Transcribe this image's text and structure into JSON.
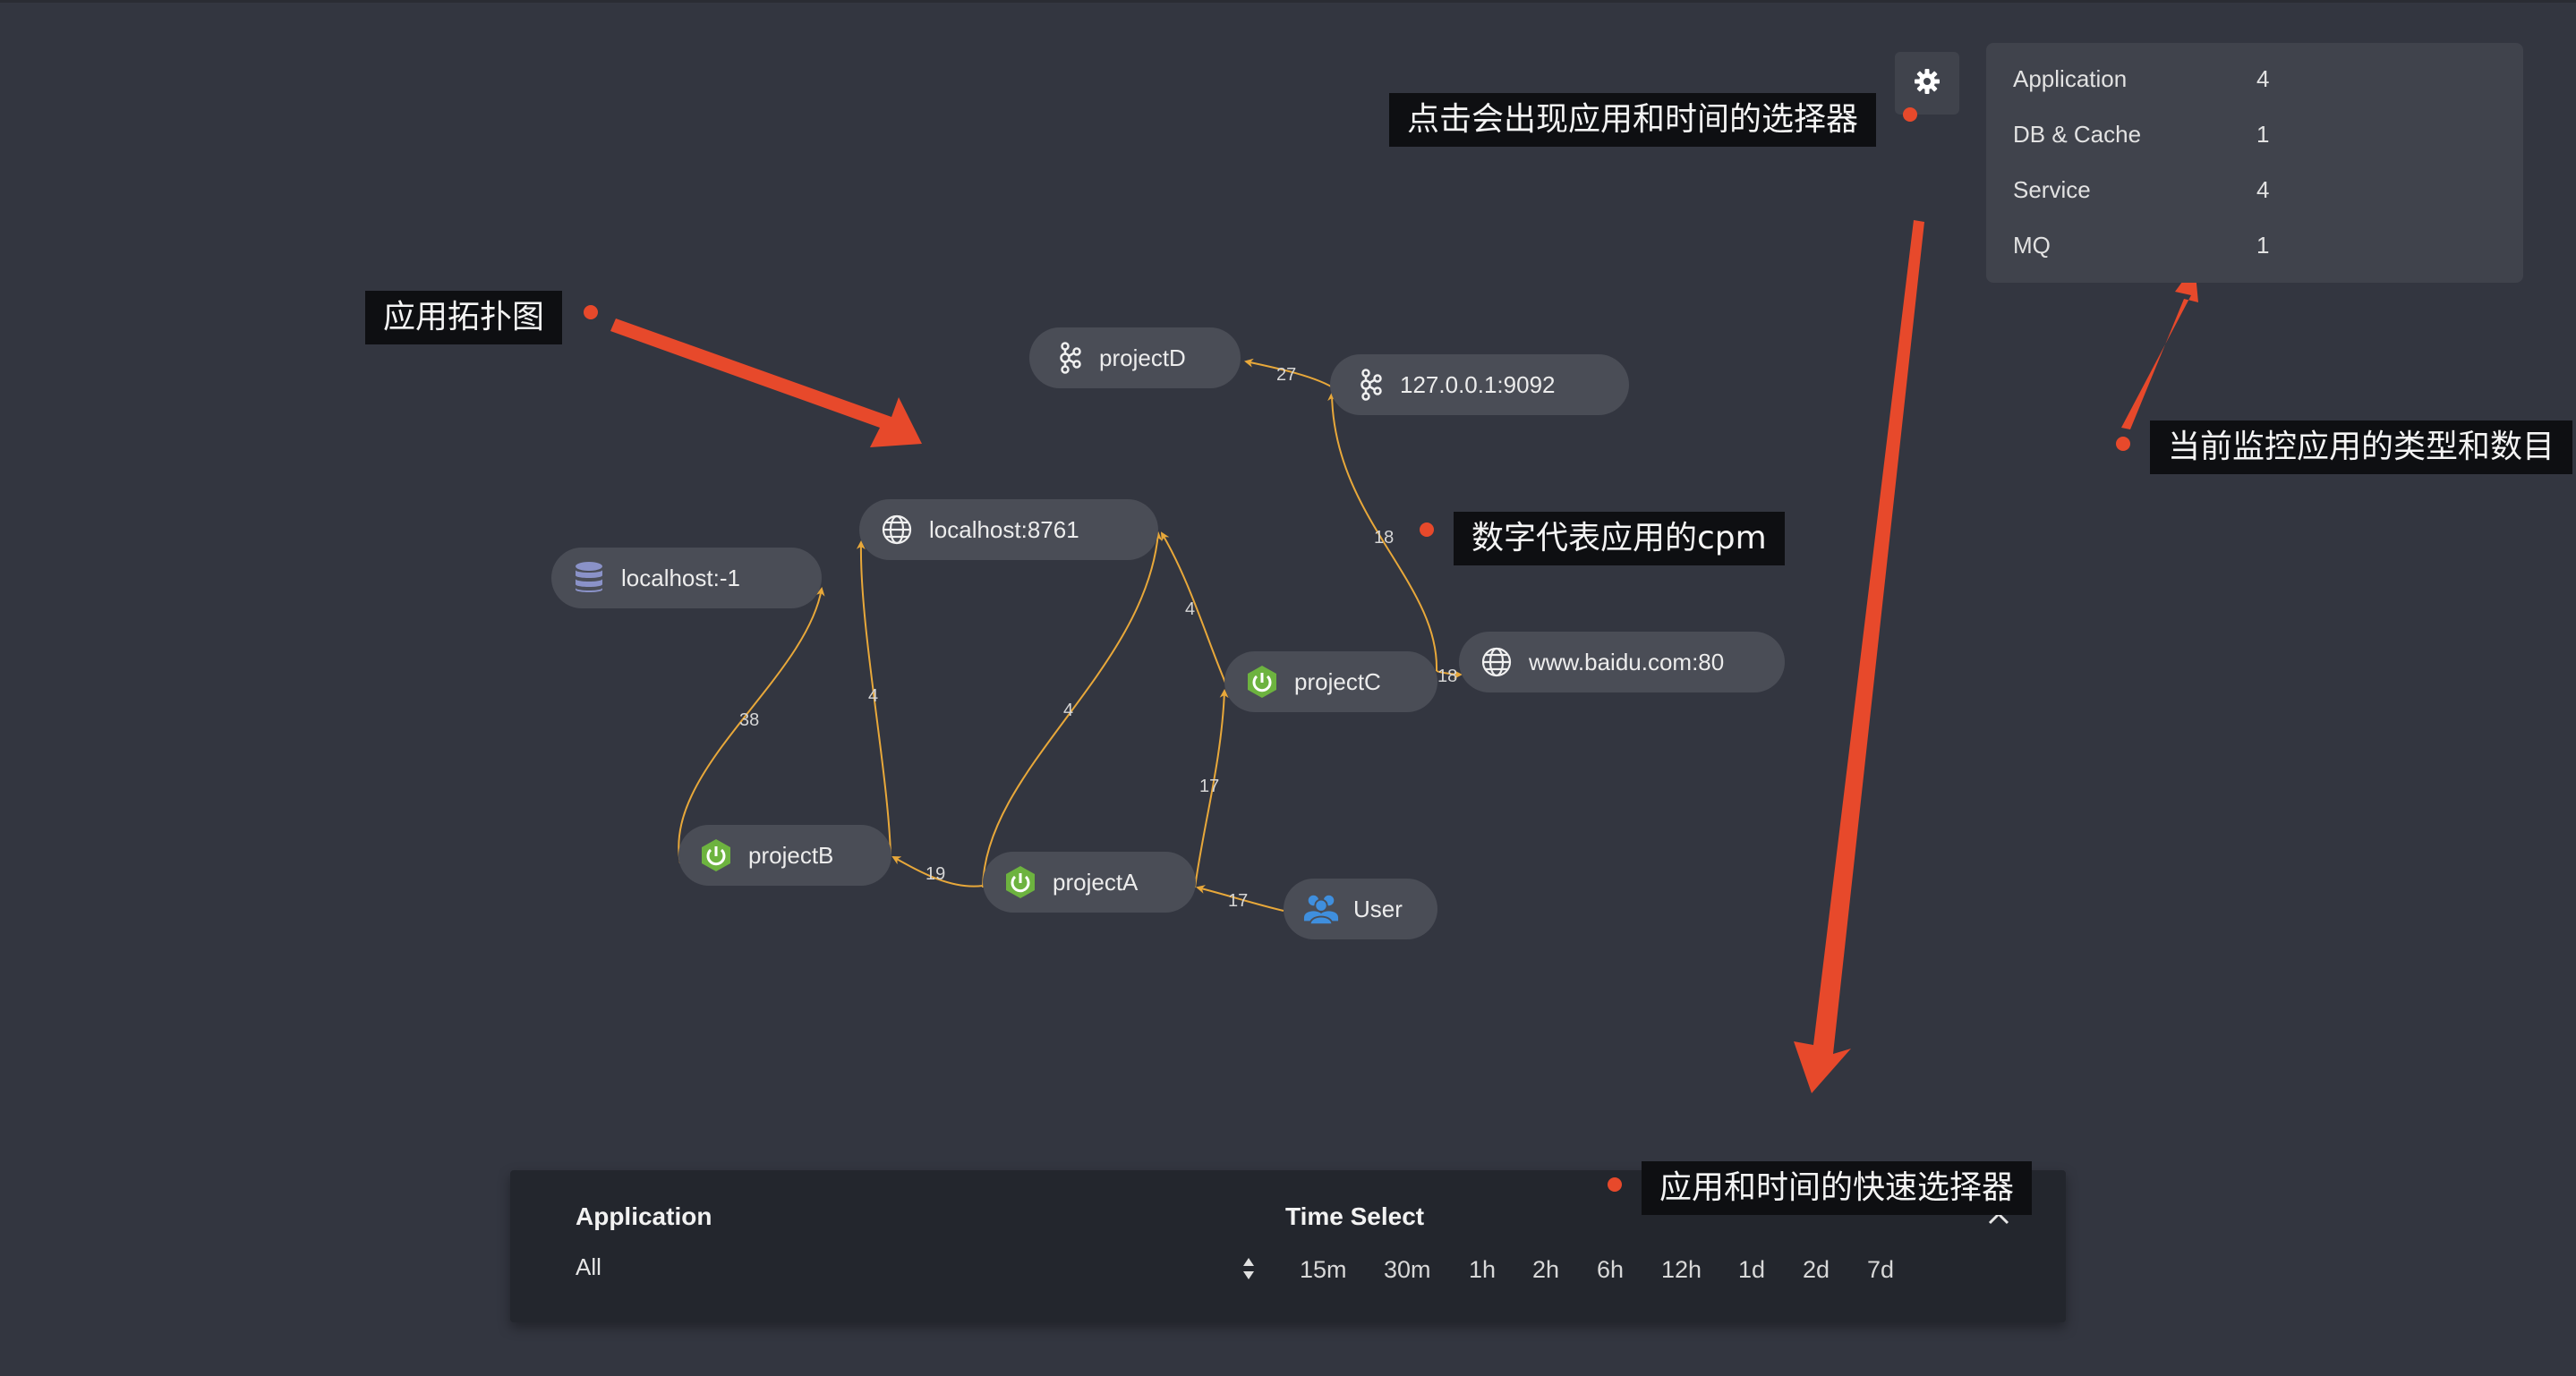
{
  "stats": {
    "rows": [
      {
        "label": "Application",
        "value": "4"
      },
      {
        "label": "DB & Cache",
        "value": "1"
      },
      {
        "label": "Service",
        "value": "4"
      },
      {
        "label": "MQ",
        "value": "1"
      }
    ]
  },
  "nodes": {
    "projectD": {
      "label": "projectD",
      "icon": "kafka-icon"
    },
    "kafka": {
      "label": "127.0.0.1:9092",
      "icon": "kafka-icon"
    },
    "localhost8761": {
      "label": "localhost:8761",
      "icon": "globe-icon"
    },
    "localhost1": {
      "label": "localhost:-1",
      "icon": "database-icon"
    },
    "projectC": {
      "label": "projectC",
      "icon": "spring-icon"
    },
    "baidu": {
      "label": "www.baidu.com:80",
      "icon": "globe-icon"
    },
    "projectB": {
      "label": "projectB",
      "icon": "spring-icon"
    },
    "projectA": {
      "label": "projectA",
      "icon": "spring-icon"
    },
    "user": {
      "label": "User",
      "icon": "users-icon"
    }
  },
  "edges": {
    "kafka_projectD": "27",
    "projectC_kafka": "18",
    "projectC_baidu": "18",
    "projectC_8761": "4",
    "projectA_8761": "4",
    "projectB_localhost1": "38",
    "projectB_8761": "4",
    "projectA_projectC": "17",
    "projectA_projectB": "19",
    "user_projectA": "17"
  },
  "callouts": {
    "settings": "点击会出现应用和时间的选择器",
    "topology": "应用拓扑图",
    "cpm": "数字代表应用的cpm",
    "stats": "当前监控应用的类型和数目",
    "quick_selector": "应用和时间的快速选择器"
  },
  "selector": {
    "application_title": "Application",
    "application_value": "All",
    "time_title": "Time Select",
    "time_options": [
      "15m",
      "30m",
      "1h",
      "2h",
      "6h",
      "12h",
      "1d",
      "2d",
      "7d"
    ]
  },
  "colors": {
    "background": "#333640",
    "node": "#4a4d56",
    "edge": "#e8a83a",
    "annotation": "#e7492b",
    "spring": "#6db33f",
    "users": "#3f8fde",
    "database": "#8a92c8"
  }
}
